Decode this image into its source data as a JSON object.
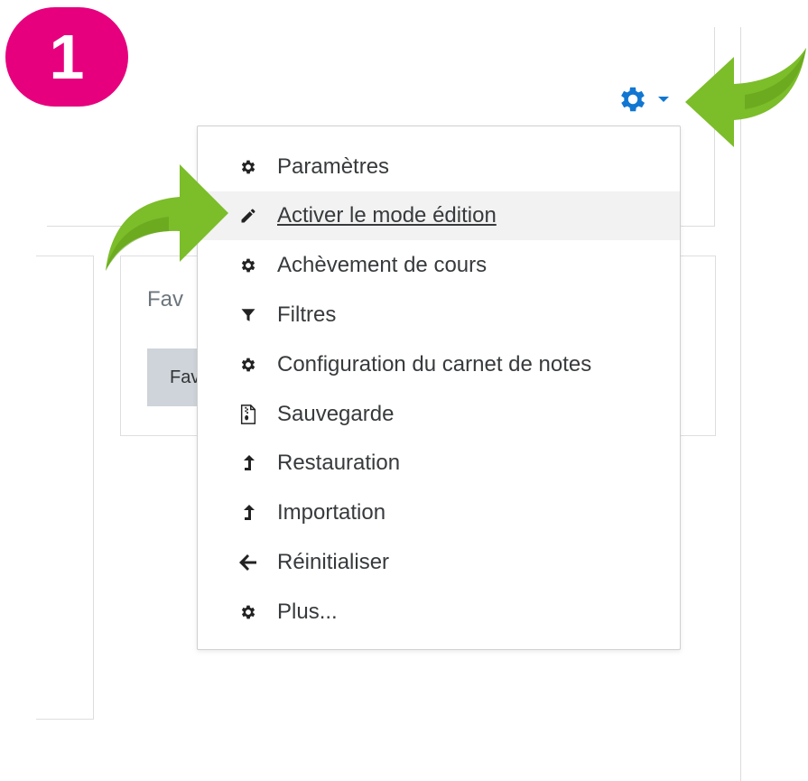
{
  "step": {
    "number": "1",
    "color": "#e6007e"
  },
  "background_panel": {
    "title": "Fav",
    "button_label": "Fav"
  },
  "trigger": {
    "icon": "gear-icon",
    "caret": "caret-down-icon",
    "color": "#1177d1"
  },
  "menu": {
    "items": [
      {
        "icon": "gear-icon",
        "label": "Paramètres"
      },
      {
        "icon": "pencil-icon",
        "label": "Activer le mode édition",
        "highlighted": true
      },
      {
        "icon": "gear-icon",
        "label": "Achèvement de cours"
      },
      {
        "icon": "filter-icon",
        "label": "Filtres"
      },
      {
        "icon": "gear-icon",
        "label": "Configuration du carnet de notes"
      },
      {
        "icon": "file-archive-icon",
        "label": "Sauvegarde"
      },
      {
        "icon": "level-up-icon",
        "label": "Restauration"
      },
      {
        "icon": "level-up-icon",
        "label": "Importation"
      },
      {
        "icon": "arrow-left-icon",
        "label": "Réinitialiser"
      },
      {
        "icon": "gear-icon",
        "label": "Plus..."
      }
    ]
  },
  "annotations": {
    "arrow_color": "#7cbd2a"
  }
}
